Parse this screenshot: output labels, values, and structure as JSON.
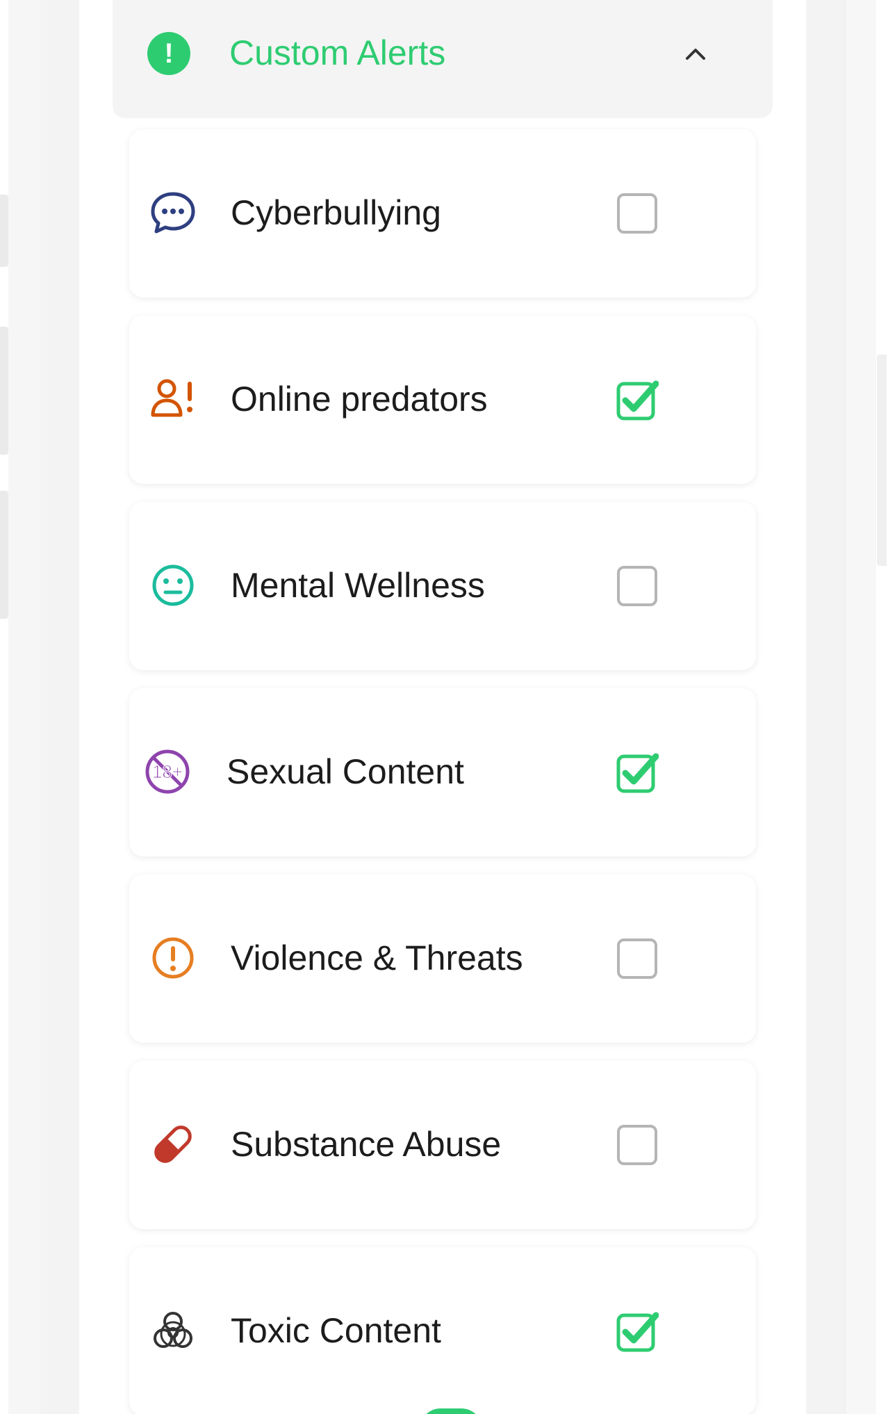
{
  "header": {
    "title": "Custom Alerts",
    "icon": "alert-circle-icon",
    "accent": "#2ecc71"
  },
  "alerts": [
    {
      "label": "Cyberbullying",
      "icon": "chat-bubble-icon",
      "icon_color": "#2e3f80",
      "checked": false
    },
    {
      "label": "Online predators",
      "icon": "user-warning-icon",
      "icon_color": "#d35400",
      "checked": true
    },
    {
      "label": "Mental Wellness",
      "icon": "neutral-face-icon",
      "icon_color": "#1abc9c",
      "checked": false
    },
    {
      "label": "Sexual Content",
      "icon": "adult-18-plus-icon",
      "icon_color": "#8e44ad",
      "checked": true
    },
    {
      "label": "Violence & Threats",
      "icon": "exclamation-circle-icon",
      "icon_color": "#e67e22",
      "checked": false
    },
    {
      "label": "Substance Abuse",
      "icon": "pill-icon",
      "icon_color": "#c0392b",
      "checked": false
    },
    {
      "label": "Toxic Content",
      "icon": "biohazard-icon",
      "icon_color": "#333333",
      "checked": true
    }
  ],
  "checkbox_color": "#2ecc71"
}
